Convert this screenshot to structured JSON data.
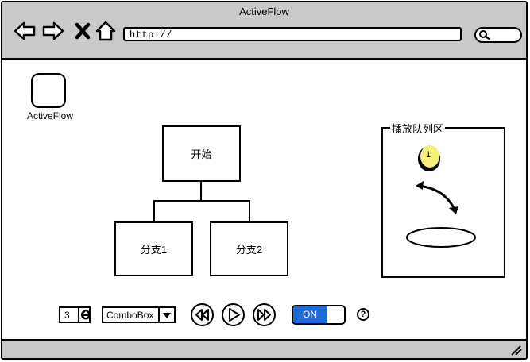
{
  "window": {
    "title": "ActiveFlow"
  },
  "toolbar": {
    "url": "http://",
    "icons": [
      "back-arrow-icon",
      "forward-arrow-icon",
      "close-x-icon",
      "home-icon",
      "search-icon"
    ]
  },
  "desktop": {
    "app_label": "ActiveFlow"
  },
  "flow": {
    "start_label": "开始",
    "branches": [
      "分支1",
      "分支2"
    ]
  },
  "queue": {
    "title": "播放队列区",
    "badge": "1",
    "badge_color": "#f5ee7a"
  },
  "controls": {
    "stepper_value": "3",
    "combo_value": "ComboBox",
    "toggle_label": "ON",
    "toggle_color": "#1e6ad6",
    "help_label": "?"
  }
}
